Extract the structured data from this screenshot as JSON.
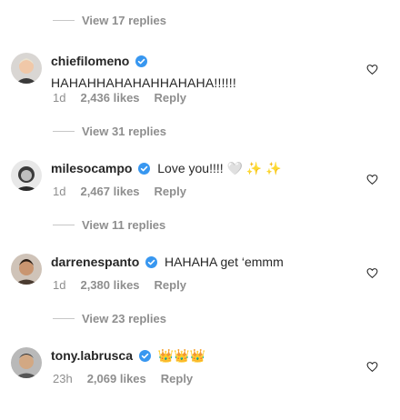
{
  "top_view_replies": "View 17 replies",
  "comments": [
    {
      "username": "chiefilomeno",
      "text": "HAHAHHAHAHAHHAHAHA!!!!!!",
      "age": "1d",
      "likes": "2,436 likes",
      "reply": "Reply",
      "view_replies": "View 31 replies"
    },
    {
      "username": "milesocampo",
      "text": "Love you!!!! 🤍 ✨ ✨",
      "age": "1d",
      "likes": "2,467 likes",
      "reply": "Reply",
      "view_replies": "View 11 replies"
    },
    {
      "username": "darrenespanto",
      "text": "HAHAHA get ‘emmm",
      "age": "1d",
      "likes": "2,380 likes",
      "reply": "Reply",
      "view_replies": "View 23 replies"
    },
    {
      "username": "tony.labrusca",
      "text": "👑👑👑",
      "age": "23h",
      "likes": "2,069 likes",
      "reply": "Reply"
    }
  ],
  "colors": {
    "verified": "#3897f0",
    "muted": "#8e8e8e",
    "text": "#262626"
  },
  "icons": {
    "verified": "verified-badge-icon",
    "like": "heart-outline-icon"
  }
}
